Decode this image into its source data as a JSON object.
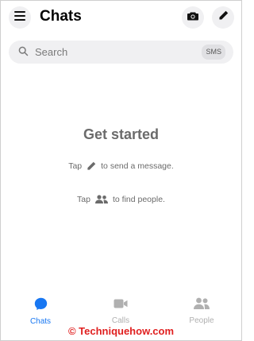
{
  "header": {
    "title": "Chats",
    "menu_icon": "hamburger-menu-icon",
    "camera_icon": "camera-icon",
    "compose_icon": "pencil-icon"
  },
  "search": {
    "placeholder": "Search",
    "sms_badge": "SMS"
  },
  "empty_state": {
    "title": "Get started",
    "hint_message_prefix": "Tap",
    "hint_message_suffix": "to send a message.",
    "hint_people_prefix": "Tap",
    "hint_people_suffix": "to find people."
  },
  "tabs": [
    {
      "label": "Chats",
      "icon": "chat-bubble-icon",
      "active": true
    },
    {
      "label": "Calls",
      "icon": "video-camera-icon",
      "active": false
    },
    {
      "label": "People",
      "icon": "people-icon",
      "active": false
    }
  ],
  "watermark": "© Techniquehow.com",
  "colors": {
    "accent": "#1877f2",
    "watermark": "#e02020",
    "muted_text": "#6b6b6b",
    "chip_bg": "#f0f0f2"
  }
}
